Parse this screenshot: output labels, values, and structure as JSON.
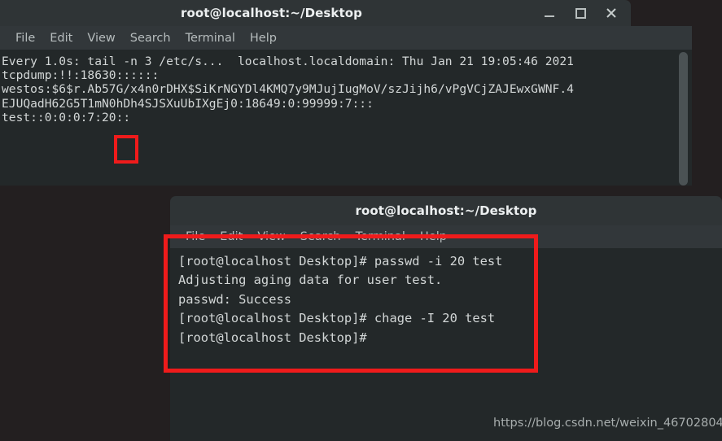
{
  "desktop": {
    "background_color": "#231f20",
    "watermark": "https://blog.csdn.net/weixin_46702804"
  },
  "window_back": {
    "title": "root@localhost:~/Desktop",
    "controls": {
      "minimize": "minimize-icon",
      "maximize": "maximize-icon",
      "close": "close-icon"
    },
    "menu": [
      "File",
      "Edit",
      "View",
      "Search",
      "Terminal",
      "Help"
    ],
    "terminal_lines": [
      "Every 1.0s: tail -n 3 /etc/s...  localhost.localdomain: Thu Jan 21 19:05:46 2021",
      "",
      "tcpdump:!!:18630::::::",
      "westos:$6$r.Ab57G/x4n0rDHX$SiKrNGYDl4KMQ7y9MJujIugMoV/szJijh6/vPgVCjZAJEwxGWNF.4",
      "EJUQadH62G5T1mN0hDh4SJSXuUbIXgEj0:18649:0:99999:7:::",
      "test::0:0:0:7:20::"
    ],
    "scrollbar": "vertical-scrollbar"
  },
  "window_front": {
    "title": "root@localhost:~/Desktop",
    "menu": [
      "File",
      "Edit",
      "View",
      "Search",
      "Terminal",
      "Help"
    ],
    "terminal_lines": [
      "[root@localhost Desktop]# passwd -i 20 test",
      "Adjusting aging data for user test.",
      "passwd: Success",
      "[root@localhost Desktop]# chage -I 20 test",
      "[root@localhost Desktop]#"
    ]
  },
  "annotations": {
    "color": "#ef1b1b",
    "boxes": [
      {
        "name": "highlight-inactive-days-value",
        "target": "20"
      },
      {
        "name": "highlight-command-output",
        "target": "passwd -i 20 test / chage -I 20 test"
      }
    ]
  }
}
